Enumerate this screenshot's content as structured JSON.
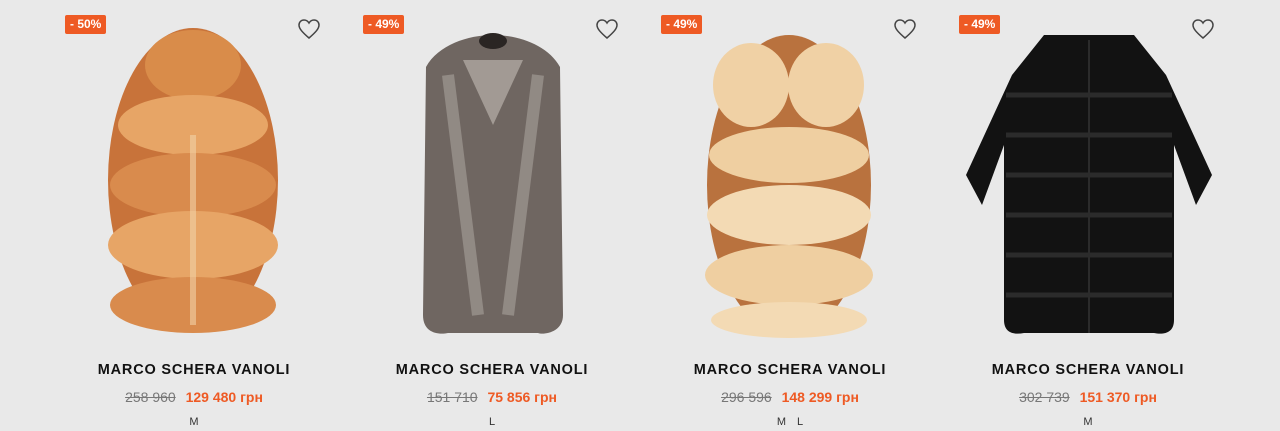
{
  "products": [
    {
      "discount": "- 50%",
      "brand": "MARCO SCHERA VANOLI",
      "old_price": "258 960",
      "new_price": "129 480 грн",
      "sizes": [
        "M"
      ],
      "image": "red-fox-fur-vest"
    },
    {
      "discount": "- 49%",
      "brand": "MARCO SCHERA VANOLI",
      "old_price": "151 710",
      "new_price": "75 856 грн",
      "sizes": [
        "L"
      ],
      "image": "silver-fox-fur-vest"
    },
    {
      "discount": "- 49%",
      "brand": "MARCO SCHERA VANOLI",
      "old_price": "296 596",
      "new_price": "148 299 грн",
      "sizes": [
        "M",
        "L"
      ],
      "image": "golden-fox-fur-vest"
    },
    {
      "discount": "- 49%",
      "brand": "MARCO SCHERA VANOLI",
      "old_price": "302 739",
      "new_price": "151 370 грн",
      "sizes": [
        "M"
      ],
      "image": "black-fur-coat"
    }
  ],
  "icons": {
    "favorite": "heart-outline-icon"
  },
  "colors": {
    "accent": "#ee5a24",
    "background": "#e9e9e9"
  }
}
